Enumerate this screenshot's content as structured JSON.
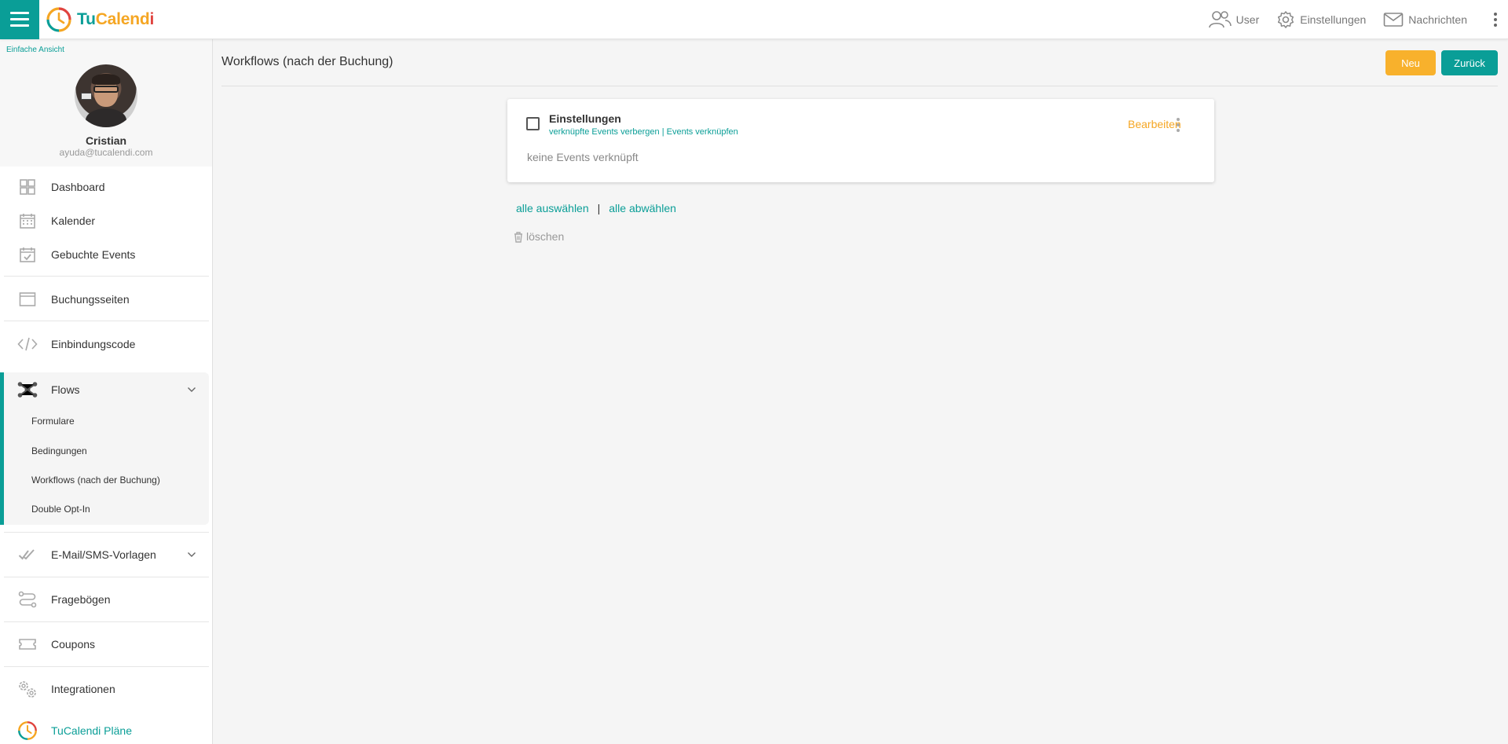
{
  "app": {
    "logo_tu": "Tu",
    "logo_cal": "Calend",
    "logo_i": "i"
  },
  "topbar": {
    "user_label": "User",
    "settings_label": "Einstellungen",
    "messages_label": "Nachrichten"
  },
  "sidebar": {
    "simple_view": "Einfache Ansicht",
    "profile": {
      "name": "Cristian",
      "email": "ayuda@tucalendi.com"
    },
    "items": {
      "dashboard": "Dashboard",
      "calendar": "Kalender",
      "booked_events": "Gebuchte Events",
      "booking_pages": "Buchungsseiten",
      "embed_code": "Einbindungscode",
      "flows": "Flows",
      "email_sms": "E-Mail/SMS-Vorlagen",
      "questionnaires": "Fragebögen",
      "coupons": "Coupons",
      "integrations": "Integrationen",
      "plans": "TuCalendi Pläne"
    },
    "flows_sub": {
      "forms": "Formulare",
      "conditions": "Bedingungen",
      "workflows": "Workflows (nach der Buchung)",
      "double_opt_in": "Double Opt-In"
    },
    "accent_color": "#0a9e97"
  },
  "main": {
    "title": "Workflows (nach der Buchung)",
    "new_label": "Neu",
    "back_label": "Zurück",
    "card": {
      "title": "Einstellungen",
      "hide_linked": "verknüpfte Events verbergen",
      "link_sep": " | ",
      "link_events": "Events verknüpfen",
      "edit_label": "Bearbeiten",
      "empty_text": "keine Events verknüpft"
    },
    "select_all": "alle auswählen",
    "select_sep": "|",
    "deselect_all": "alle abwählen",
    "delete_label": "löschen"
  },
  "colors": {
    "primary": "#0a9e97",
    "warning": "#f8b12c"
  }
}
